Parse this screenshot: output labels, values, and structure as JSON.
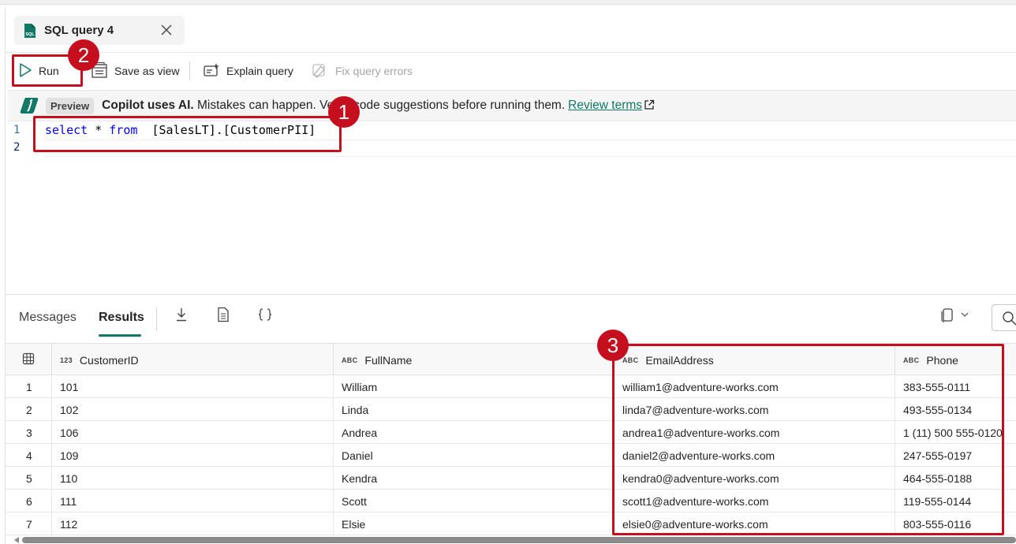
{
  "tab": {
    "title": "SQL query 4",
    "icon_text": "SQL"
  },
  "toolbar": {
    "run": "Run",
    "save_as_view": "Save as view",
    "explain_query": "Explain query",
    "fix_query_errors": "Fix query errors"
  },
  "banner": {
    "preview": "Preview",
    "bold": "Copilot uses AI.",
    "text": " Mistakes can happen. Verify code suggestions before running them.",
    "link": "Review terms"
  },
  "editor": {
    "line_numbers": [
      "1",
      "2"
    ],
    "kw_select": "select",
    "star": " * ",
    "kw_from": "from",
    "rest": "  [SalesLT].[CustomerPII]"
  },
  "results": {
    "tabs": [
      "Messages",
      "Results"
    ],
    "active_tab": "Results"
  },
  "table": {
    "columns": [
      {
        "type": "123",
        "name": "CustomerID"
      },
      {
        "type": "ABC",
        "name": "FullName"
      },
      {
        "type": "ABC",
        "name": "EmailAddress"
      },
      {
        "type": "ABC",
        "name": "Phone"
      }
    ],
    "rows": [
      [
        "1",
        "101",
        "William",
        "william1@adventure-works.com",
        "383-555-0111"
      ],
      [
        "2",
        "102",
        "Linda",
        "linda7@adventure-works.com",
        "493-555-0134"
      ],
      [
        "3",
        "106",
        "Andrea",
        "andrea1@adventure-works.com",
        "1 (11) 500 555-0120"
      ],
      [
        "4",
        "109",
        "Daniel",
        "daniel2@adventure-works.com",
        "247-555-0197"
      ],
      [
        "5",
        "110",
        "Kendra",
        "kendra0@adventure-works.com",
        "464-555-0188"
      ],
      [
        "6",
        "111",
        "Scott",
        "scott1@adventure-works.com",
        "119-555-0144"
      ],
      [
        "7",
        "112",
        "Elsie",
        "elsie0@adventure-works.com",
        "803-555-0116"
      ]
    ]
  },
  "callouts": [
    "1",
    "2",
    "3"
  ],
  "colors": {
    "accent": "#117865",
    "callout": "#c50f1f"
  }
}
